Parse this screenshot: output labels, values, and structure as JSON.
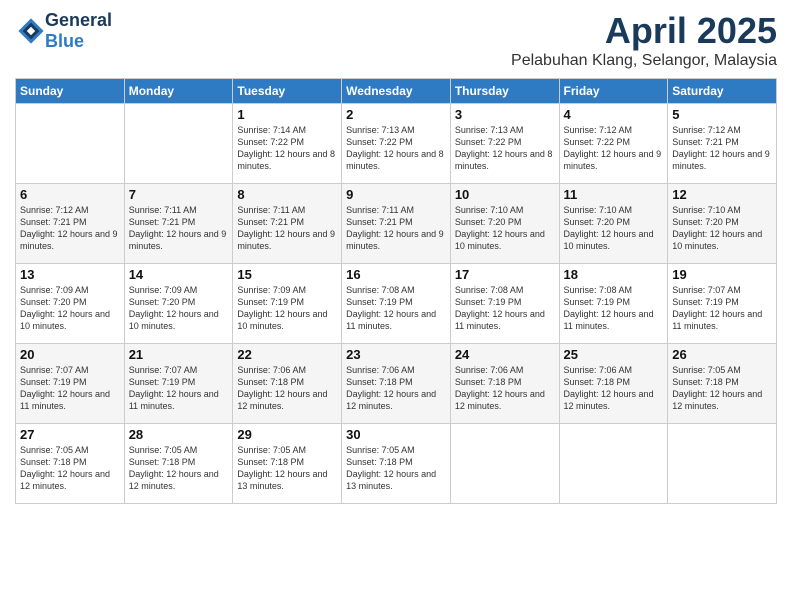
{
  "logo": {
    "general": "General",
    "blue": "Blue"
  },
  "header": {
    "title": "April 2025",
    "subtitle": "Pelabuhan Klang, Selangor, Malaysia"
  },
  "weekdays": [
    "Sunday",
    "Monday",
    "Tuesday",
    "Wednesday",
    "Thursday",
    "Friday",
    "Saturday"
  ],
  "weeks": [
    [
      {
        "day": "",
        "info": ""
      },
      {
        "day": "",
        "info": ""
      },
      {
        "day": "1",
        "info": "Sunrise: 7:14 AM\nSunset: 7:22 PM\nDaylight: 12 hours and 8 minutes."
      },
      {
        "day": "2",
        "info": "Sunrise: 7:13 AM\nSunset: 7:22 PM\nDaylight: 12 hours and 8 minutes."
      },
      {
        "day": "3",
        "info": "Sunrise: 7:13 AM\nSunset: 7:22 PM\nDaylight: 12 hours and 8 minutes."
      },
      {
        "day": "4",
        "info": "Sunrise: 7:12 AM\nSunset: 7:22 PM\nDaylight: 12 hours and 9 minutes."
      },
      {
        "day": "5",
        "info": "Sunrise: 7:12 AM\nSunset: 7:21 PM\nDaylight: 12 hours and 9 minutes."
      }
    ],
    [
      {
        "day": "6",
        "info": "Sunrise: 7:12 AM\nSunset: 7:21 PM\nDaylight: 12 hours and 9 minutes."
      },
      {
        "day": "7",
        "info": "Sunrise: 7:11 AM\nSunset: 7:21 PM\nDaylight: 12 hours and 9 minutes."
      },
      {
        "day": "8",
        "info": "Sunrise: 7:11 AM\nSunset: 7:21 PM\nDaylight: 12 hours and 9 minutes."
      },
      {
        "day": "9",
        "info": "Sunrise: 7:11 AM\nSunset: 7:21 PM\nDaylight: 12 hours and 9 minutes."
      },
      {
        "day": "10",
        "info": "Sunrise: 7:10 AM\nSunset: 7:20 PM\nDaylight: 12 hours and 10 minutes."
      },
      {
        "day": "11",
        "info": "Sunrise: 7:10 AM\nSunset: 7:20 PM\nDaylight: 12 hours and 10 minutes."
      },
      {
        "day": "12",
        "info": "Sunrise: 7:10 AM\nSunset: 7:20 PM\nDaylight: 12 hours and 10 minutes."
      }
    ],
    [
      {
        "day": "13",
        "info": "Sunrise: 7:09 AM\nSunset: 7:20 PM\nDaylight: 12 hours and 10 minutes."
      },
      {
        "day": "14",
        "info": "Sunrise: 7:09 AM\nSunset: 7:20 PM\nDaylight: 12 hours and 10 minutes."
      },
      {
        "day": "15",
        "info": "Sunrise: 7:09 AM\nSunset: 7:19 PM\nDaylight: 12 hours and 10 minutes."
      },
      {
        "day": "16",
        "info": "Sunrise: 7:08 AM\nSunset: 7:19 PM\nDaylight: 12 hours and 11 minutes."
      },
      {
        "day": "17",
        "info": "Sunrise: 7:08 AM\nSunset: 7:19 PM\nDaylight: 12 hours and 11 minutes."
      },
      {
        "day": "18",
        "info": "Sunrise: 7:08 AM\nSunset: 7:19 PM\nDaylight: 12 hours and 11 minutes."
      },
      {
        "day": "19",
        "info": "Sunrise: 7:07 AM\nSunset: 7:19 PM\nDaylight: 12 hours and 11 minutes."
      }
    ],
    [
      {
        "day": "20",
        "info": "Sunrise: 7:07 AM\nSunset: 7:19 PM\nDaylight: 12 hours and 11 minutes."
      },
      {
        "day": "21",
        "info": "Sunrise: 7:07 AM\nSunset: 7:19 PM\nDaylight: 12 hours and 11 minutes."
      },
      {
        "day": "22",
        "info": "Sunrise: 7:06 AM\nSunset: 7:18 PM\nDaylight: 12 hours and 12 minutes."
      },
      {
        "day": "23",
        "info": "Sunrise: 7:06 AM\nSunset: 7:18 PM\nDaylight: 12 hours and 12 minutes."
      },
      {
        "day": "24",
        "info": "Sunrise: 7:06 AM\nSunset: 7:18 PM\nDaylight: 12 hours and 12 minutes."
      },
      {
        "day": "25",
        "info": "Sunrise: 7:06 AM\nSunset: 7:18 PM\nDaylight: 12 hours and 12 minutes."
      },
      {
        "day": "26",
        "info": "Sunrise: 7:05 AM\nSunset: 7:18 PM\nDaylight: 12 hours and 12 minutes."
      }
    ],
    [
      {
        "day": "27",
        "info": "Sunrise: 7:05 AM\nSunset: 7:18 PM\nDaylight: 12 hours and 12 minutes."
      },
      {
        "day": "28",
        "info": "Sunrise: 7:05 AM\nSunset: 7:18 PM\nDaylight: 12 hours and 12 minutes."
      },
      {
        "day": "29",
        "info": "Sunrise: 7:05 AM\nSunset: 7:18 PM\nDaylight: 12 hours and 13 minutes."
      },
      {
        "day": "30",
        "info": "Sunrise: 7:05 AM\nSunset: 7:18 PM\nDaylight: 12 hours and 13 minutes."
      },
      {
        "day": "",
        "info": ""
      },
      {
        "day": "",
        "info": ""
      },
      {
        "day": "",
        "info": ""
      }
    ]
  ]
}
